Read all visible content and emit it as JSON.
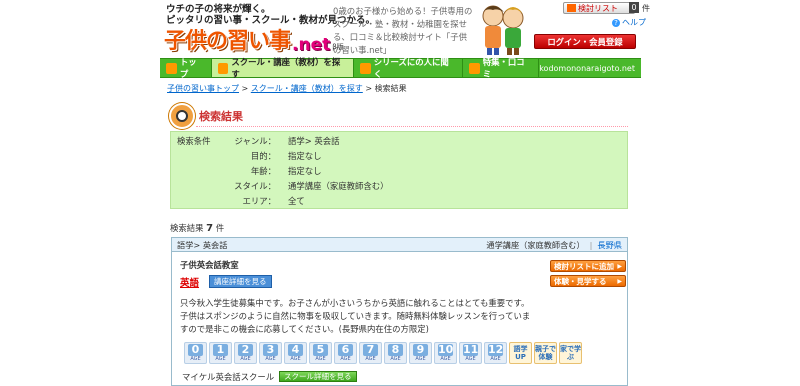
{
  "header": {
    "tagline_line1": "ウチの子の将来が輝く。",
    "tagline_line2": "ピッタリの習い事・スクール・教材が見つかる。",
    "logo_kids": "子供の習い事",
    "logo_net": ".net",
    "logo_beta": "β版",
    "intro": "0歳のお子様から始める！子供専用のスクール・塾・教材・幼稚園を探せる、口コミ＆比較検討サイト「子供の習い事.net」",
    "compare_list_label": "検討リスト",
    "compare_count": "0",
    "compare_unit": "件",
    "help_label": "ヘルプ",
    "login_label": "ログイン・会員登録"
  },
  "nav": {
    "items": [
      {
        "label": "トップ"
      },
      {
        "label": "スクール・講座（教材）を探す"
      },
      {
        "label": "シリーズにの人に聞く"
      },
      {
        "label": "特集・口コミ"
      }
    ],
    "domain": "kodomononaraigoto.net"
  },
  "breadcrumb": {
    "home": "子供の習い事トップ",
    "sep": " > ",
    "search": "スクール・講座（教材）を探す",
    "current": "検索結果"
  },
  "section_title": "検索結果",
  "conditions": {
    "label": "検索条件",
    "rows": [
      {
        "key": "ジャンル：",
        "value": "語学> 英会話"
      },
      {
        "key": "目的：",
        "value": "指定なし"
      },
      {
        "key": "年齢：",
        "value": "指定なし"
      },
      {
        "key": "スタイル：",
        "value": "通学講座（家庭教師含む）"
      },
      {
        "key": "エリア：",
        "value": "全て"
      }
    ]
  },
  "result": {
    "prefix": "検索結果 ",
    "count": "7",
    "suffix": " 件"
  },
  "card": {
    "genre": "語学> 英会話",
    "style": "通学講座（家庭教師含む）",
    "sep": "|",
    "prefecture": "長野県",
    "school_name": "子供英会話教室",
    "subject": "英語",
    "detail_button": "講座詳細を見る",
    "add_compare_button": "検討リストに追加",
    "trial_button": "体験・見学する",
    "description": "只今秋入学生徒募集中です。お子さんが小さいうちから英語に触れることはとても重要です。子供はスポンジのように自然に物事を吸収していきます。随時無料体験レッスンを行っていますので是非この機会に応募してください。(長野県内在住の方限定)",
    "ages": [
      "0",
      "1",
      "2",
      "3",
      "4",
      "5",
      "6",
      "7",
      "8",
      "9",
      "10",
      "11",
      "12"
    ],
    "age_unit": "AGE",
    "tags": [
      "語学UP",
      "親子で体験",
      "家で学ぶ"
    ],
    "school_name2": "マイケル英会話スクール",
    "school_detail_button": "スクール詳細を見る"
  }
}
